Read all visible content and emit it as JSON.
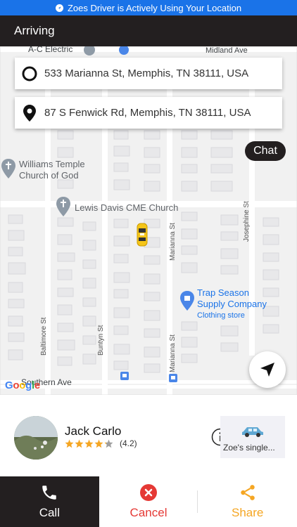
{
  "banner": {
    "text": "Zoes Driver is Actively Using Your Location"
  },
  "header": {
    "title": "Arriving"
  },
  "trip": {
    "pickup": "533 Marianna St, Memphis, TN 38111, USA",
    "dropoff": "87 S Fenwick Rd, Memphis, TN 38111, USA"
  },
  "map": {
    "chat_label": "Chat",
    "poi": {
      "ac_electric": "A-C Electric",
      "midland_ave": "Midland Ave",
      "williams_temple_1": "Williams Temple",
      "williams_temple_2": "Church of God",
      "lewis_davis": "Lewis Davis CME Church",
      "trap_season_1": "Trap Season",
      "trap_season_2": "Supply Company",
      "clothing_store": "Clothing store",
      "southern_ave": "Southern Ave"
    },
    "streets": {
      "baltimore": "Baltimore St",
      "buntyn": "Buntyn St",
      "marianna_1": "Marianna St",
      "marianna_2": "Marianna St",
      "josephine": "Josephine St"
    },
    "google": "Google"
  },
  "driver": {
    "name": "Jack Carlo",
    "rating_text": "(4.2)",
    "rating_value": 4.2,
    "rating_max": 5,
    "vehicle": "Zoe's single..."
  },
  "actions": {
    "call": "Call",
    "cancel": "Cancel",
    "share": "Share"
  },
  "colors": {
    "banner": "#1a73e8",
    "header": "#231f20",
    "cancel": "#e53935",
    "share": "#f5a623",
    "star": "#f5a623"
  }
}
